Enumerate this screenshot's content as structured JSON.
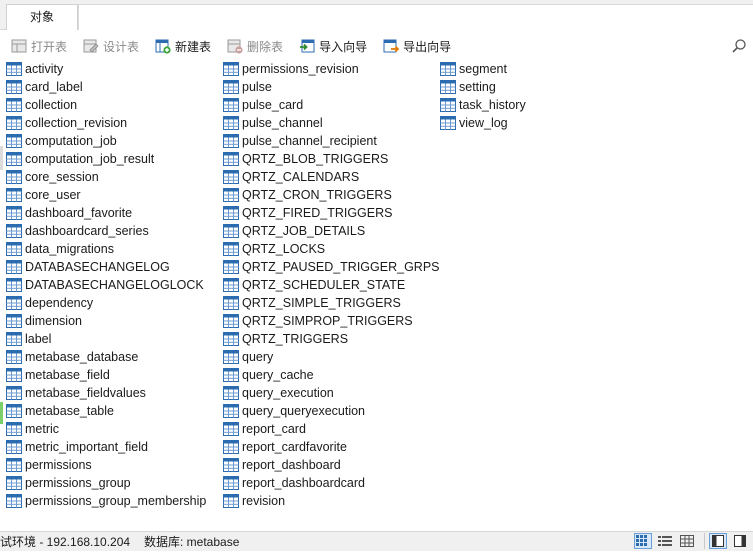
{
  "tabs": [
    {
      "label": "对象"
    }
  ],
  "toolbar": {
    "open_table": "打开表",
    "design_table": "设计表",
    "new_table": "新建表",
    "delete_table": "删除表",
    "import_wizard": "导入向导",
    "export_wizard": "导出向导"
  },
  "tables": {
    "column1": [
      "activity",
      "card_label",
      "collection",
      "collection_revision",
      "computation_job",
      "computation_job_result",
      "core_session",
      "core_user",
      "dashboard_favorite",
      "dashboardcard_series",
      "data_migrations",
      "DATABASECHANGELOG",
      "DATABASECHANGELOGLOCK",
      "dependency",
      "dimension",
      "label",
      "metabase_database",
      "metabase_field",
      "metabase_fieldvalues",
      "metabase_table",
      "metric",
      "metric_important_field",
      "permissions",
      "permissions_group",
      "permissions_group_membership"
    ],
    "column2": [
      "permissions_revision",
      "pulse",
      "pulse_card",
      "pulse_channel",
      "pulse_channel_recipient",
      "QRTZ_BLOB_TRIGGERS",
      "QRTZ_CALENDARS",
      "QRTZ_CRON_TRIGGERS",
      "QRTZ_FIRED_TRIGGERS",
      "QRTZ_JOB_DETAILS",
      "QRTZ_LOCKS",
      "QRTZ_PAUSED_TRIGGER_GRPS",
      "QRTZ_SCHEDULER_STATE",
      "QRTZ_SIMPLE_TRIGGERS",
      "QRTZ_SIMPROP_TRIGGERS",
      "QRTZ_TRIGGERS",
      "query",
      "query_cache",
      "query_execution",
      "query_queryexecution",
      "report_card",
      "report_cardfavorite",
      "report_dashboard",
      "report_dashboardcard",
      "revision"
    ],
    "column3": [
      "segment",
      "setting",
      "task_history",
      "view_log"
    ]
  },
  "status": {
    "connection": "试环境 - 192.168.10.204",
    "database": "数据库: metabase"
  },
  "colors": {
    "table_icon_blue": "#2b6cb0",
    "toolbar_bg": "#f0f0f0",
    "active_view_border": "#6a9fd8"
  }
}
